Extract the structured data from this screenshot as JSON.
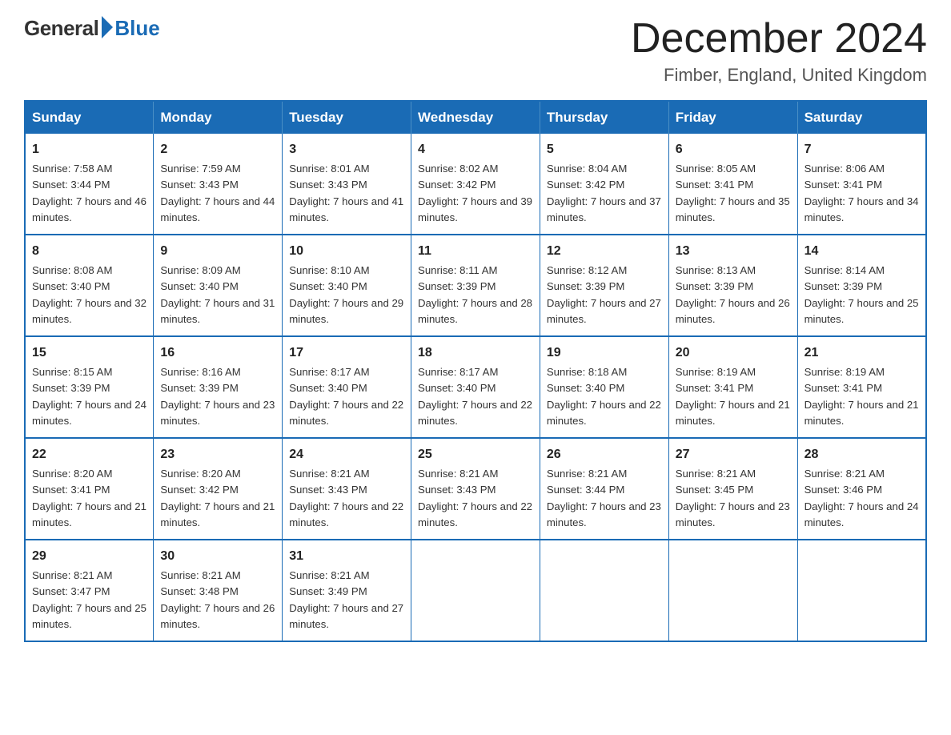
{
  "header": {
    "logo_general": "General",
    "logo_blue": "Blue",
    "month_title": "December 2024",
    "location": "Fimber, England, United Kingdom"
  },
  "days_of_week": [
    "Sunday",
    "Monday",
    "Tuesday",
    "Wednesday",
    "Thursday",
    "Friday",
    "Saturday"
  ],
  "weeks": [
    [
      {
        "day": "1",
        "sunrise": "7:58 AM",
        "sunset": "3:44 PM",
        "daylight": "7 hours and 46 minutes."
      },
      {
        "day": "2",
        "sunrise": "7:59 AM",
        "sunset": "3:43 PM",
        "daylight": "7 hours and 44 minutes."
      },
      {
        "day": "3",
        "sunrise": "8:01 AM",
        "sunset": "3:43 PM",
        "daylight": "7 hours and 41 minutes."
      },
      {
        "day": "4",
        "sunrise": "8:02 AM",
        "sunset": "3:42 PM",
        "daylight": "7 hours and 39 minutes."
      },
      {
        "day": "5",
        "sunrise": "8:04 AM",
        "sunset": "3:42 PM",
        "daylight": "7 hours and 37 minutes."
      },
      {
        "day": "6",
        "sunrise": "8:05 AM",
        "sunset": "3:41 PM",
        "daylight": "7 hours and 35 minutes."
      },
      {
        "day": "7",
        "sunrise": "8:06 AM",
        "sunset": "3:41 PM",
        "daylight": "7 hours and 34 minutes."
      }
    ],
    [
      {
        "day": "8",
        "sunrise": "8:08 AM",
        "sunset": "3:40 PM",
        "daylight": "7 hours and 32 minutes."
      },
      {
        "day": "9",
        "sunrise": "8:09 AM",
        "sunset": "3:40 PM",
        "daylight": "7 hours and 31 minutes."
      },
      {
        "day": "10",
        "sunrise": "8:10 AM",
        "sunset": "3:40 PM",
        "daylight": "7 hours and 29 minutes."
      },
      {
        "day": "11",
        "sunrise": "8:11 AM",
        "sunset": "3:39 PM",
        "daylight": "7 hours and 28 minutes."
      },
      {
        "day": "12",
        "sunrise": "8:12 AM",
        "sunset": "3:39 PM",
        "daylight": "7 hours and 27 minutes."
      },
      {
        "day": "13",
        "sunrise": "8:13 AM",
        "sunset": "3:39 PM",
        "daylight": "7 hours and 26 minutes."
      },
      {
        "day": "14",
        "sunrise": "8:14 AM",
        "sunset": "3:39 PM",
        "daylight": "7 hours and 25 minutes."
      }
    ],
    [
      {
        "day": "15",
        "sunrise": "8:15 AM",
        "sunset": "3:39 PM",
        "daylight": "7 hours and 24 minutes."
      },
      {
        "day": "16",
        "sunrise": "8:16 AM",
        "sunset": "3:39 PM",
        "daylight": "7 hours and 23 minutes."
      },
      {
        "day": "17",
        "sunrise": "8:17 AM",
        "sunset": "3:40 PM",
        "daylight": "7 hours and 22 minutes."
      },
      {
        "day": "18",
        "sunrise": "8:17 AM",
        "sunset": "3:40 PM",
        "daylight": "7 hours and 22 minutes."
      },
      {
        "day": "19",
        "sunrise": "8:18 AM",
        "sunset": "3:40 PM",
        "daylight": "7 hours and 22 minutes."
      },
      {
        "day": "20",
        "sunrise": "8:19 AM",
        "sunset": "3:41 PM",
        "daylight": "7 hours and 21 minutes."
      },
      {
        "day": "21",
        "sunrise": "8:19 AM",
        "sunset": "3:41 PM",
        "daylight": "7 hours and 21 minutes."
      }
    ],
    [
      {
        "day": "22",
        "sunrise": "8:20 AM",
        "sunset": "3:41 PM",
        "daylight": "7 hours and 21 minutes."
      },
      {
        "day": "23",
        "sunrise": "8:20 AM",
        "sunset": "3:42 PM",
        "daylight": "7 hours and 21 minutes."
      },
      {
        "day": "24",
        "sunrise": "8:21 AM",
        "sunset": "3:43 PM",
        "daylight": "7 hours and 22 minutes."
      },
      {
        "day": "25",
        "sunrise": "8:21 AM",
        "sunset": "3:43 PM",
        "daylight": "7 hours and 22 minutes."
      },
      {
        "day": "26",
        "sunrise": "8:21 AM",
        "sunset": "3:44 PM",
        "daylight": "7 hours and 23 minutes."
      },
      {
        "day": "27",
        "sunrise": "8:21 AM",
        "sunset": "3:45 PM",
        "daylight": "7 hours and 23 minutes."
      },
      {
        "day": "28",
        "sunrise": "8:21 AM",
        "sunset": "3:46 PM",
        "daylight": "7 hours and 24 minutes."
      }
    ],
    [
      {
        "day": "29",
        "sunrise": "8:21 AM",
        "sunset": "3:47 PM",
        "daylight": "7 hours and 25 minutes."
      },
      {
        "day": "30",
        "sunrise": "8:21 AM",
        "sunset": "3:48 PM",
        "daylight": "7 hours and 26 minutes."
      },
      {
        "day": "31",
        "sunrise": "8:21 AM",
        "sunset": "3:49 PM",
        "daylight": "7 hours and 27 minutes."
      },
      null,
      null,
      null,
      null
    ]
  ]
}
